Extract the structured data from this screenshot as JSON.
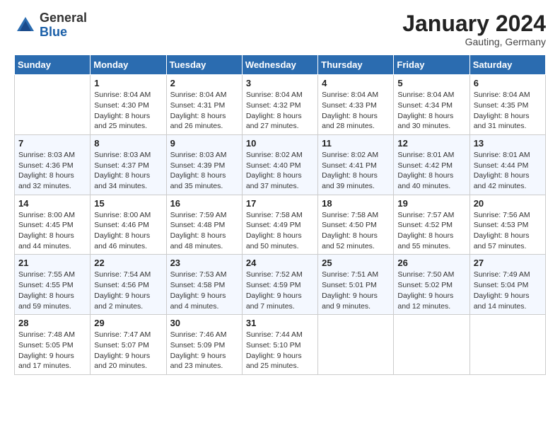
{
  "header": {
    "logo_general": "General",
    "logo_blue": "Blue",
    "month_title": "January 2024",
    "subtitle": "Gauting, Germany"
  },
  "days_of_week": [
    "Sunday",
    "Monday",
    "Tuesday",
    "Wednesday",
    "Thursday",
    "Friday",
    "Saturday"
  ],
  "weeks": [
    [
      {
        "day": "",
        "info": []
      },
      {
        "day": "1",
        "info": [
          "Sunrise: 8:04 AM",
          "Sunset: 4:30 PM",
          "Daylight: 8 hours",
          "and 25 minutes."
        ]
      },
      {
        "day": "2",
        "info": [
          "Sunrise: 8:04 AM",
          "Sunset: 4:31 PM",
          "Daylight: 8 hours",
          "and 26 minutes."
        ]
      },
      {
        "day": "3",
        "info": [
          "Sunrise: 8:04 AM",
          "Sunset: 4:32 PM",
          "Daylight: 8 hours",
          "and 27 minutes."
        ]
      },
      {
        "day": "4",
        "info": [
          "Sunrise: 8:04 AM",
          "Sunset: 4:33 PM",
          "Daylight: 8 hours",
          "and 28 minutes."
        ]
      },
      {
        "day": "5",
        "info": [
          "Sunrise: 8:04 AM",
          "Sunset: 4:34 PM",
          "Daylight: 8 hours",
          "and 30 minutes."
        ]
      },
      {
        "day": "6",
        "info": [
          "Sunrise: 8:04 AM",
          "Sunset: 4:35 PM",
          "Daylight: 8 hours",
          "and 31 minutes."
        ]
      }
    ],
    [
      {
        "day": "7",
        "info": [
          "Sunrise: 8:03 AM",
          "Sunset: 4:36 PM",
          "Daylight: 8 hours",
          "and 32 minutes."
        ]
      },
      {
        "day": "8",
        "info": [
          "Sunrise: 8:03 AM",
          "Sunset: 4:37 PM",
          "Daylight: 8 hours",
          "and 34 minutes."
        ]
      },
      {
        "day": "9",
        "info": [
          "Sunrise: 8:03 AM",
          "Sunset: 4:39 PM",
          "Daylight: 8 hours",
          "and 35 minutes."
        ]
      },
      {
        "day": "10",
        "info": [
          "Sunrise: 8:02 AM",
          "Sunset: 4:40 PM",
          "Daylight: 8 hours",
          "and 37 minutes."
        ]
      },
      {
        "day": "11",
        "info": [
          "Sunrise: 8:02 AM",
          "Sunset: 4:41 PM",
          "Daylight: 8 hours",
          "and 39 minutes."
        ]
      },
      {
        "day": "12",
        "info": [
          "Sunrise: 8:01 AM",
          "Sunset: 4:42 PM",
          "Daylight: 8 hours",
          "and 40 minutes."
        ]
      },
      {
        "day": "13",
        "info": [
          "Sunrise: 8:01 AM",
          "Sunset: 4:44 PM",
          "Daylight: 8 hours",
          "and 42 minutes."
        ]
      }
    ],
    [
      {
        "day": "14",
        "info": [
          "Sunrise: 8:00 AM",
          "Sunset: 4:45 PM",
          "Daylight: 8 hours",
          "and 44 minutes."
        ]
      },
      {
        "day": "15",
        "info": [
          "Sunrise: 8:00 AM",
          "Sunset: 4:46 PM",
          "Daylight: 8 hours",
          "and 46 minutes."
        ]
      },
      {
        "day": "16",
        "info": [
          "Sunrise: 7:59 AM",
          "Sunset: 4:48 PM",
          "Daylight: 8 hours",
          "and 48 minutes."
        ]
      },
      {
        "day": "17",
        "info": [
          "Sunrise: 7:58 AM",
          "Sunset: 4:49 PM",
          "Daylight: 8 hours",
          "and 50 minutes."
        ]
      },
      {
        "day": "18",
        "info": [
          "Sunrise: 7:58 AM",
          "Sunset: 4:50 PM",
          "Daylight: 8 hours",
          "and 52 minutes."
        ]
      },
      {
        "day": "19",
        "info": [
          "Sunrise: 7:57 AM",
          "Sunset: 4:52 PM",
          "Daylight: 8 hours",
          "and 55 minutes."
        ]
      },
      {
        "day": "20",
        "info": [
          "Sunrise: 7:56 AM",
          "Sunset: 4:53 PM",
          "Daylight: 8 hours",
          "and 57 minutes."
        ]
      }
    ],
    [
      {
        "day": "21",
        "info": [
          "Sunrise: 7:55 AM",
          "Sunset: 4:55 PM",
          "Daylight: 8 hours",
          "and 59 minutes."
        ]
      },
      {
        "day": "22",
        "info": [
          "Sunrise: 7:54 AM",
          "Sunset: 4:56 PM",
          "Daylight: 9 hours",
          "and 2 minutes."
        ]
      },
      {
        "day": "23",
        "info": [
          "Sunrise: 7:53 AM",
          "Sunset: 4:58 PM",
          "Daylight: 9 hours",
          "and 4 minutes."
        ]
      },
      {
        "day": "24",
        "info": [
          "Sunrise: 7:52 AM",
          "Sunset: 4:59 PM",
          "Daylight: 9 hours",
          "and 7 minutes."
        ]
      },
      {
        "day": "25",
        "info": [
          "Sunrise: 7:51 AM",
          "Sunset: 5:01 PM",
          "Daylight: 9 hours",
          "and 9 minutes."
        ]
      },
      {
        "day": "26",
        "info": [
          "Sunrise: 7:50 AM",
          "Sunset: 5:02 PM",
          "Daylight: 9 hours",
          "and 12 minutes."
        ]
      },
      {
        "day": "27",
        "info": [
          "Sunrise: 7:49 AM",
          "Sunset: 5:04 PM",
          "Daylight: 9 hours",
          "and 14 minutes."
        ]
      }
    ],
    [
      {
        "day": "28",
        "info": [
          "Sunrise: 7:48 AM",
          "Sunset: 5:05 PM",
          "Daylight: 9 hours",
          "and 17 minutes."
        ]
      },
      {
        "day": "29",
        "info": [
          "Sunrise: 7:47 AM",
          "Sunset: 5:07 PM",
          "Daylight: 9 hours",
          "and 20 minutes."
        ]
      },
      {
        "day": "30",
        "info": [
          "Sunrise: 7:46 AM",
          "Sunset: 5:09 PM",
          "Daylight: 9 hours",
          "and 23 minutes."
        ]
      },
      {
        "day": "31",
        "info": [
          "Sunrise: 7:44 AM",
          "Sunset: 5:10 PM",
          "Daylight: 9 hours",
          "and 25 minutes."
        ]
      },
      {
        "day": "",
        "info": []
      },
      {
        "day": "",
        "info": []
      },
      {
        "day": "",
        "info": []
      }
    ]
  ]
}
